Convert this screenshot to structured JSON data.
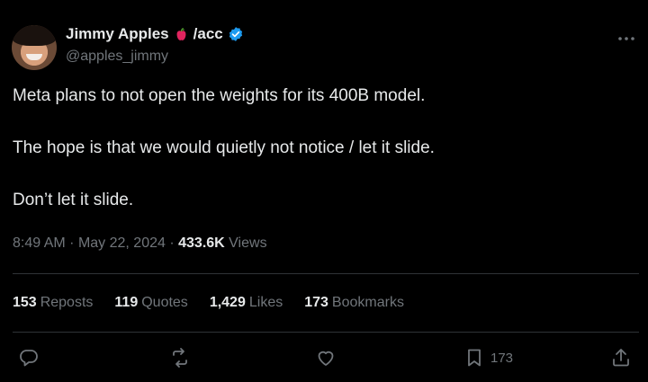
{
  "author": {
    "name": "Jimmy Apples",
    "name_suffix": "/acc",
    "handle": "@apples_jimmy"
  },
  "tweet": {
    "paragraphs": [
      "Meta plans to not open the weights for its 400B model.",
      "The hope is that we would quietly not notice / let it slide.",
      "Don’t let it slide."
    ]
  },
  "meta": {
    "time": "8:49 AM",
    "separator1": "·",
    "date": "May 22, 2024",
    "separator2": "·",
    "views_count": "433.6K",
    "views_label": "Views"
  },
  "stats": {
    "reposts_count": "153",
    "reposts_label": "Reposts",
    "quotes_count": "119",
    "quotes_label": "Quotes",
    "likes_count": "1,429",
    "likes_label": "Likes",
    "bookmarks_count": "173",
    "bookmarks_label": "Bookmarks"
  },
  "actions": {
    "bookmark_count": "173"
  },
  "colors": {
    "background": "#000000",
    "text": "#e7e9ea",
    "muted": "#71767b",
    "divider": "#2f3336",
    "verified": "#1d9bf0",
    "apple": "#e0245e"
  },
  "icons": {
    "more": "more-dots-icon",
    "reply": "reply-icon",
    "repost": "repost-icon",
    "like": "heart-icon",
    "bookmark": "bookmark-icon",
    "share": "share-icon"
  }
}
